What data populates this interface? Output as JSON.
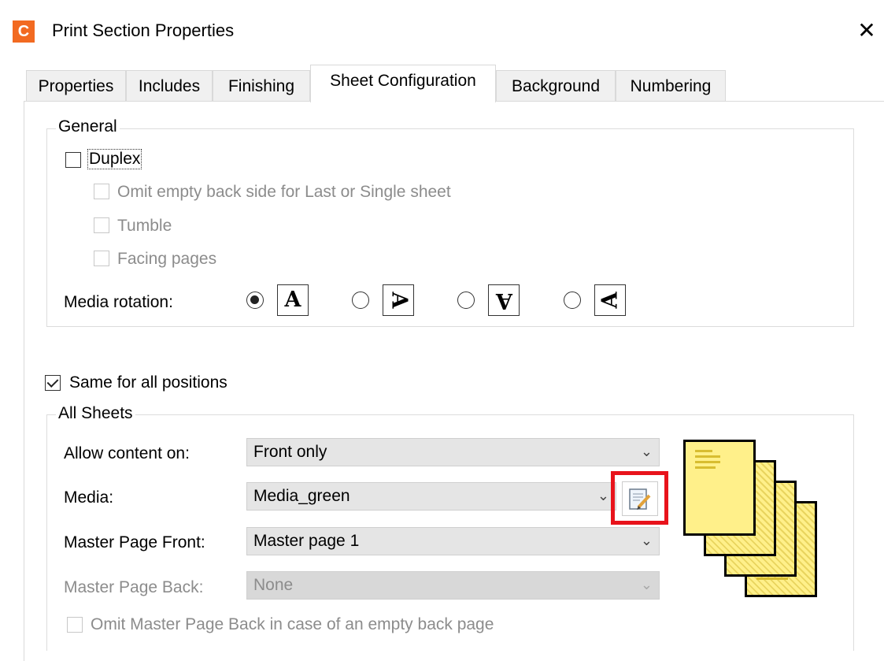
{
  "window": {
    "title": "Print Section Properties",
    "app_icon_letter": "C",
    "close_symbol": "✕",
    "accent_color": "#f26a21"
  },
  "tabs": [
    {
      "label": "Properties",
      "active": false
    },
    {
      "label": "Includes",
      "active": false
    },
    {
      "label": "Finishing",
      "active": false
    },
    {
      "label": "Sheet Configuration",
      "active": true
    },
    {
      "label": "Background",
      "active": false
    },
    {
      "label": "Numbering",
      "active": false
    }
  ],
  "general": {
    "legend": "General",
    "duplex": {
      "label": "Duplex",
      "checked": false
    },
    "omit_empty_back": {
      "label": "Omit empty back side for Last or Single sheet",
      "checked": false,
      "enabled": false
    },
    "tumble": {
      "label": "Tumble",
      "checked": false,
      "enabled": false
    },
    "facing_pages": {
      "label": "Facing pages",
      "checked": false,
      "enabled": false
    },
    "media_rotation": {
      "label": "Media rotation:",
      "options": [
        {
          "glyph": "A",
          "selected": true,
          "icon": "rotation-0-icon"
        },
        {
          "glyph": "A",
          "selected": false,
          "icon": "rotation-90-icon"
        },
        {
          "glyph": "A",
          "selected": false,
          "icon": "rotation-180-icon"
        },
        {
          "glyph": "A",
          "selected": false,
          "icon": "rotation-270-icon"
        }
      ]
    }
  },
  "same_for_all_positions": {
    "label": "Same for all positions",
    "checked": true
  },
  "all_sheets": {
    "legend": "All Sheets",
    "allow_content_on": {
      "label": "Allow content on:",
      "value": "Front only"
    },
    "media": {
      "label": "Media:",
      "value": "Media_green"
    },
    "master_page_front": {
      "label": "Master Page Front:",
      "value": "Master page 1"
    },
    "master_page_back": {
      "label": "Master Page Back:",
      "value": "None",
      "enabled": false
    },
    "omit_master_back": {
      "label": "Omit Master Page Back in case of an empty back page",
      "checked": false,
      "enabled": false
    }
  },
  "highlight_color": "#e8131b",
  "sheet_color": "#fff08a"
}
